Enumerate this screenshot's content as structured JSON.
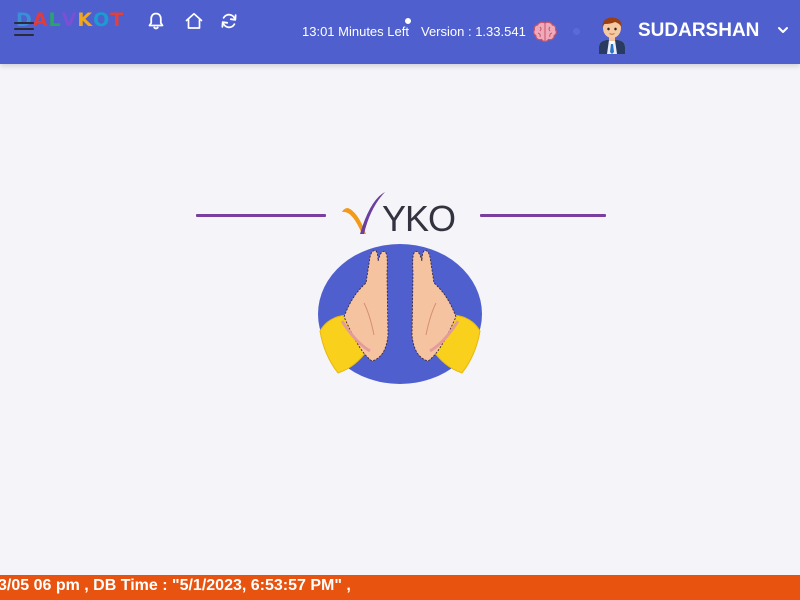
{
  "header": {
    "logo_letters": [
      "D",
      "A",
      "L",
      "V",
      "K",
      "O",
      "T"
    ],
    "logo_colors": [
      "#3a8fd6",
      "#e23b3b",
      "#2aa56a",
      "#7b4fd6",
      "#f2a71b",
      "#1d9bd1",
      "#e2413b"
    ],
    "icons": [
      "menu-icon",
      "bell-icon",
      "home-icon",
      "refresh-icon",
      "brain-icon"
    ],
    "timer_text": "13:01 Minutes Left",
    "version_text": "Version : 1.33.541",
    "username": "SUDARSHAN",
    "background_color": "#4f5fcd"
  },
  "main": {
    "brand_text": "YKO",
    "checkmark_colors": [
      "#f29a1c",
      "#6a3fa0"
    ],
    "divider_color": "#7a3ea1",
    "illustration": "namaste-hands",
    "illustration_bg": "#4f5fcd"
  },
  "footer": {
    "ticker_text": "3/05 06 pm , DB Time : \"5/1/2023, 6:53:57 PM\" ,",
    "background_color": "#e8540f"
  }
}
